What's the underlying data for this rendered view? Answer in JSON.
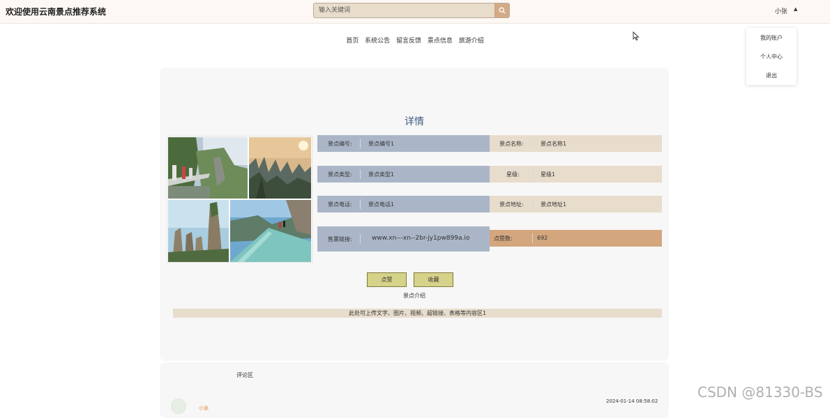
{
  "header": {
    "site_title": "欢迎使用云南景点推荐系统",
    "search_placeholder": "输入关键词",
    "search_icon": "search-icon",
    "user_name": "小张"
  },
  "user_menu": {
    "items": [
      "我的账户",
      "个人中心",
      "退出"
    ]
  },
  "nav": {
    "items": [
      "首页",
      "系统公告",
      "留言反馈",
      "景点信息",
      "旅游介绍"
    ]
  },
  "detail": {
    "title": "详情",
    "fields": {
      "code_label": "景点编号:",
      "code_value": "景点编号1",
      "name_label": "景点名称:",
      "name_value": "景点名称1",
      "type_label": "景点类型:",
      "type_value": "景点类型1",
      "star_label": "星级:",
      "star_value": "星级1",
      "phone_label": "景点电话:",
      "phone_value": "景点电话1",
      "address_label": "景点地址:",
      "address_value": "景点地址1",
      "link_label": "售票链接:",
      "link_value": "www.xn---xn--2br-jy1pw899a.io",
      "likes_label": "点赞数:",
      "likes_value": "692"
    },
    "like_button": "点赞",
    "favorite_button": "收藏",
    "intro_title": "景点介绍",
    "intro_content": "此处可上传文字、图片、视频、超链接、表格等内容区1"
  },
  "comments": {
    "title": "评论区",
    "first_time": "2024-01-14 08:58:02",
    "first_user_partial": "小张"
  },
  "watermark": "CSDN @81330-BS",
  "colors": {
    "header_bg": "#fdf8f3",
    "label_blue": "#aab6c8",
    "label_beige": "#e8dccc",
    "likes_tan": "#d3a67e",
    "button_yellow": "#d6d28a",
    "title_blue": "#3d5a80"
  }
}
